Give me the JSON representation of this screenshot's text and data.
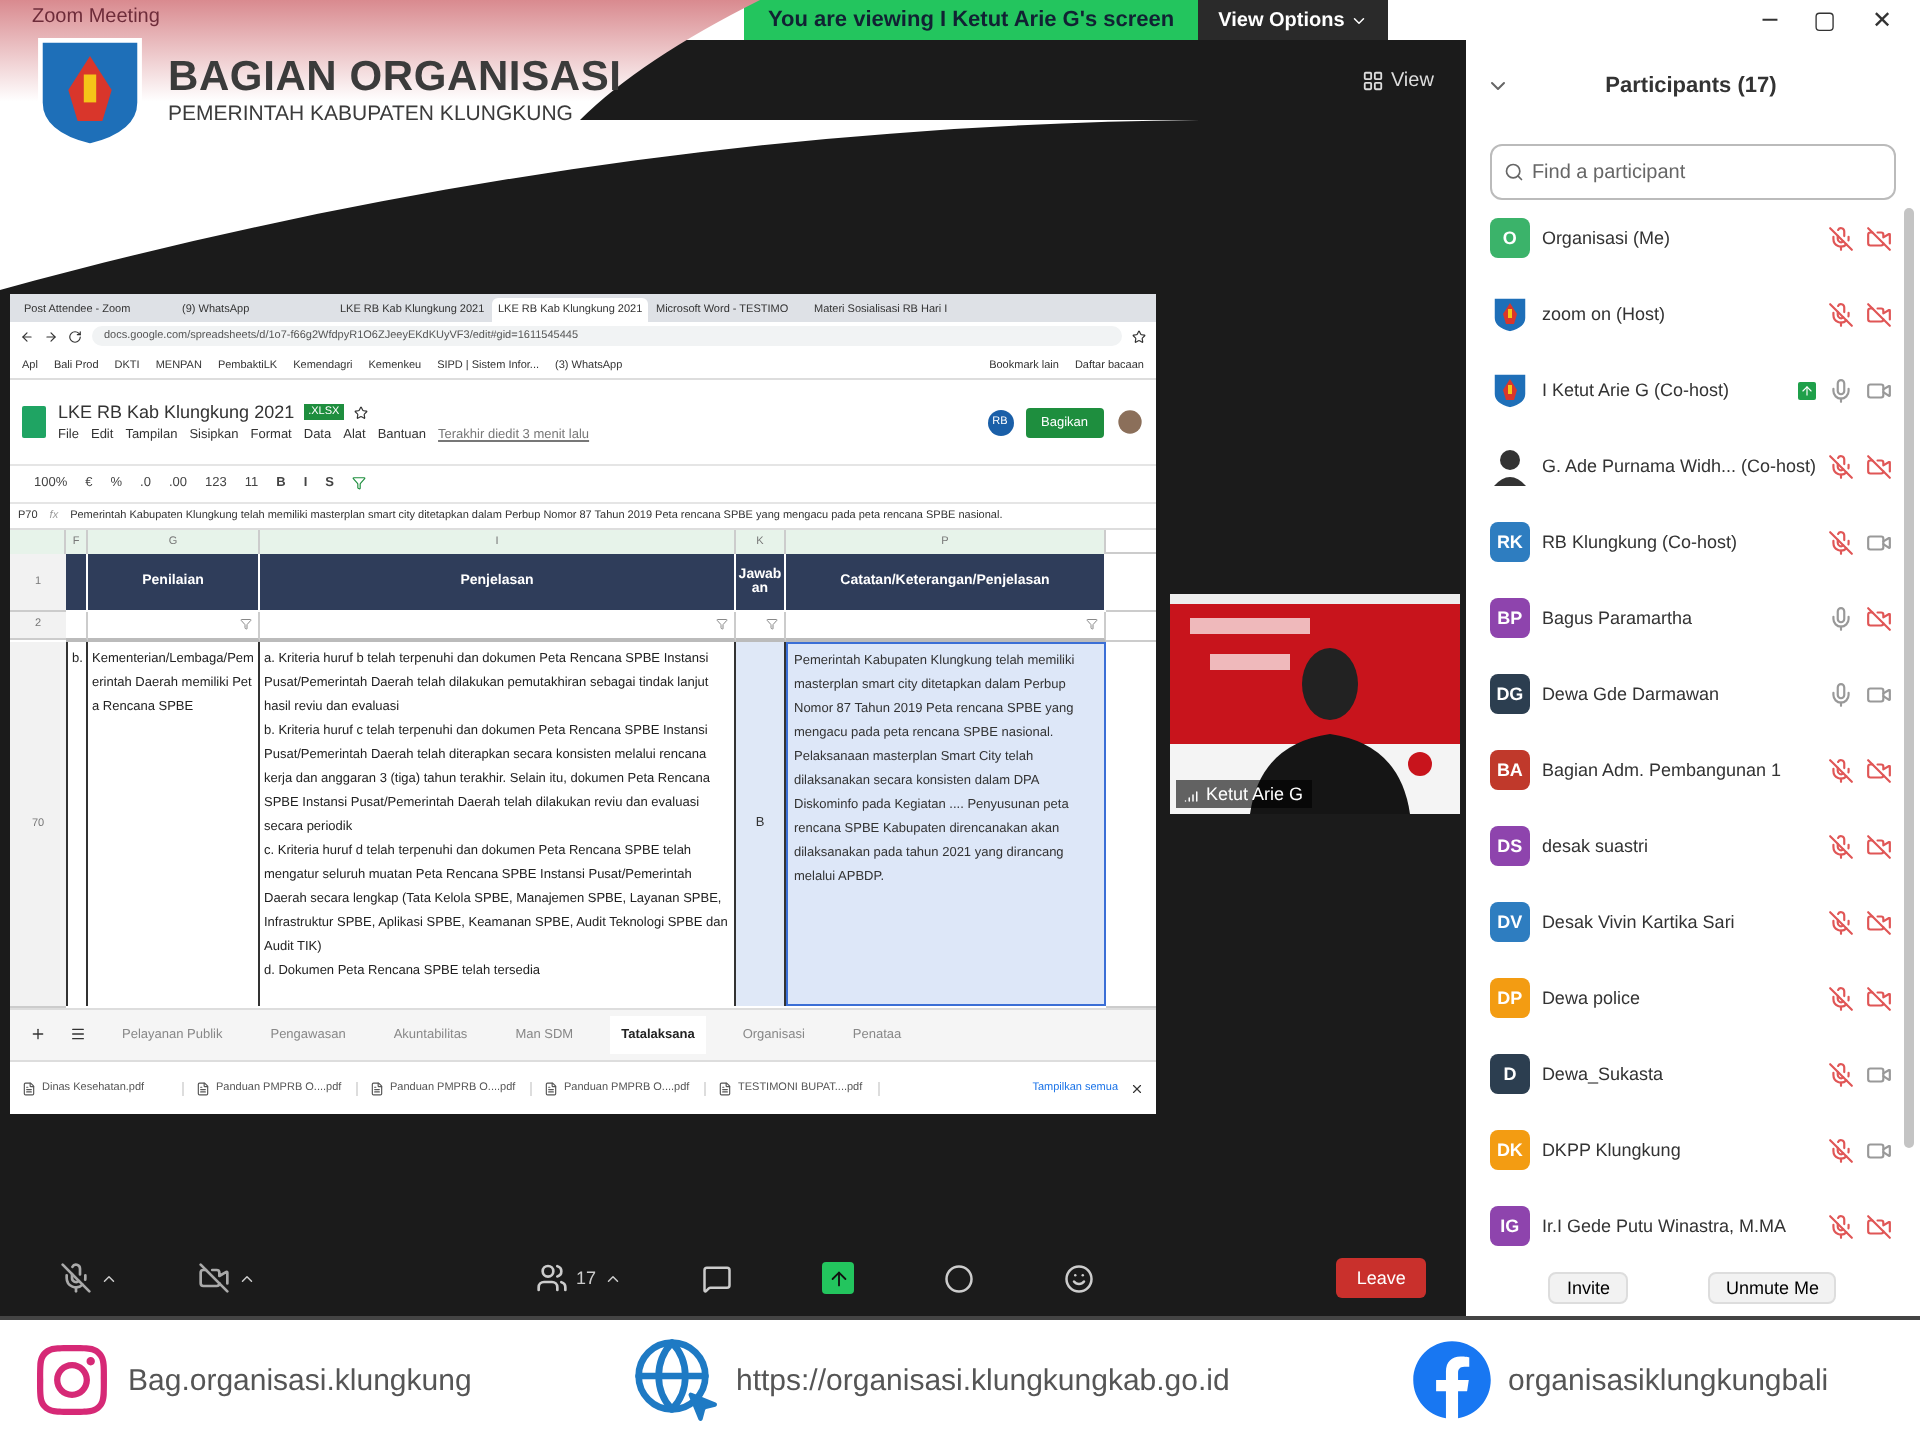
{
  "window": {
    "title": "Zoom Meeting",
    "controls": [
      "─",
      "▢",
      "✕"
    ]
  },
  "banner": {
    "title": "BAGIAN ORGANISASI",
    "subtitle": "PEMERINTAH KABUPATEN KLUNGKUNG"
  },
  "share_notice": {
    "text": "You are viewing I Ketut Arie G's screen",
    "options": "View Options"
  },
  "view_button": "View",
  "shared_screen": {
    "browser_tabs": [
      {
        "label": "Post Attendee - Zoom",
        "selected": false
      },
      {
        "label": "(9) WhatsApp",
        "selected": false
      },
      {
        "label": "LKE RB Kab Klungkung 2021",
        "selected": false
      },
      {
        "label": "LKE RB Kab Klungkung 2021",
        "selected": true
      },
      {
        "label": "Microsoft Word - TESTIMO",
        "selected": false
      },
      {
        "label": "Materi Sosialisasi RB Hari I",
        "selected": false
      }
    ],
    "url": "docs.google.com/spreadsheets/d/1o7-f66g2WfdpyR1O6ZJeeyEKdKUyVF3/edit#gid=1611545445",
    "bookmarks": [
      "Apl",
      "Bali Prod",
      "DKTI",
      "MENPAN",
      "PembaktiLK",
      "Kemendagri",
      "Kemenkeu",
      "SIPD | Sistem Infor...",
      "(3) WhatsApp"
    ],
    "bookmarks_right": [
      "Bookmark lain",
      "Daftar bacaan"
    ],
    "doc_title": "LKE RB Kab Klungkung 2021",
    "doc_badge": ".XLSX",
    "menus": [
      "File",
      "Edit",
      "Tampilan",
      "Sisipkan",
      "Format",
      "Data",
      "Alat",
      "Bantuan"
    ],
    "last_edit": "Terakhir diedit 3 menit lalu",
    "collaborator": "RB",
    "share_button": "Bagikan",
    "toolbar": [
      "100%",
      "€",
      "%",
      ".0",
      ".00",
      "123",
      "11",
      "B",
      "I",
      "S"
    ],
    "cell_ref": "P70",
    "fx": "fx",
    "formula": "Pemerintah Kabupaten Klungkung telah memiliki masterplan smart city ditetapkan dalam Perbup Nomor 87 Tahun 2019 Peta rencana SPBE yang mengacu pada peta rencana SPBE nasional.",
    "columns": [
      "F",
      "G",
      "I",
      "K",
      "P"
    ],
    "header_row": {
      "number": "1",
      "cells": [
        "Penilaian",
        "Penjelasan",
        "Jawaban",
        "Catatan/Keterangan/Penjelasan"
      ]
    },
    "filter_row": {
      "number": "2"
    },
    "row": {
      "number": "70",
      "item": "b.",
      "penilaian": "Kementerian/Lembaga/Pemerintah Daerah memiliki Peta Rencana SPBE",
      "penjelasan": [
        "a. Kriteria huruf b telah terpenuhi dan dokumen Peta Rencana SPBE Instansi Pusat/Pemerintah Daerah telah dilakukan pemutakhiran sebagai tindak lanjut hasil reviu dan evaluasi",
        "b. Kriteria huruf c telah terpenuhi dan dokumen Peta Rencana SPBE Instansi Pusat/Pemerintah Daerah telah diterapkan secara konsisten melalui rencana kerja dan anggaran 3 (tiga) tahun terakhir. Selain itu, dokumen Peta Rencana SPBE Instansi Pusat/Pemerintah Daerah telah dilakukan reviu dan evaluasi secara periodik",
        "c. Kriteria huruf d telah terpenuhi dan dokumen Peta Rencana SPBE telah mengatur seluruh muatan Peta Rencana SPBE Instansi Pusat/Pemerintah Daerah secara lengkap (Tata Kelola SPBE, Manajemen SPBE, Layanan SPBE, Infrastruktur SPBE, Aplikasi SPBE, Keamanan SPBE, Audit Teknologi SPBE dan Audit TIK)",
        "d. Dokumen Peta Rencana SPBE telah tersedia"
      ],
      "jawaban": "B",
      "catatan": "Pemerintah Kabupaten Klungkung telah memiliki masterplan smart city ditetapkan dalam Perbup Nomor 87 Tahun 2019 Peta rencana SPBE yang mengacu pada peta rencana SPBE nasional. Pelaksanaan masterplan Smart City telah dilaksanakan secara konsisten dalam DPA Diskominfo pada Kegiatan .... Penyusunan peta rencana SPBE Kabupaten direncanakan akan dilaksanakan pada tahun 2021 yang dirancang melalui APBDP."
    },
    "sheet_tabs": [
      {
        "label": "Pelayanan Publik",
        "selected": false
      },
      {
        "label": "Pengawasan",
        "selected": false
      },
      {
        "label": "Akuntabilitas",
        "selected": false
      },
      {
        "label": "Man SDM",
        "selected": false
      },
      {
        "label": "Tatalaksana",
        "selected": true
      },
      {
        "label": "Organisasi",
        "selected": false
      },
      {
        "label": "Penataa",
        "selected": false
      }
    ],
    "downloads": [
      "Dinas Kesehatan.pdf",
      "Panduan PMPRB O....pdf",
      "Panduan PMPRB O....pdf",
      "Panduan PMPRB O....pdf",
      "TESTIMONI BUPAT....pdf"
    ],
    "show_all": "Tampilkan semua"
  },
  "video_tile": {
    "name": "Ketut Arie G"
  },
  "participants": {
    "title": "Participants (17)",
    "search_placeholder": "Find a participant",
    "rows": [
      {
        "kind": "initials",
        "initials": "O",
        "color": "#3bb36a",
        "name": "Organisasi (Me)",
        "sharing": false,
        "mic_muted": true,
        "video_off": true
      },
      {
        "kind": "emblem",
        "name": "zoom on (Host)",
        "sharing": false,
        "mic_muted": true,
        "video_off": true
      },
      {
        "kind": "emblem",
        "name": "I Ketut Arie G (Co-host)",
        "sharing": true,
        "mic_muted": false,
        "video_off": false
      },
      {
        "kind": "person",
        "name": "G. Ade Purnama Widh... (Co-host)",
        "sharing": false,
        "mic_muted": true,
        "video_off": true
      },
      {
        "kind": "initials",
        "initials": "RK",
        "color": "#2e7dc0",
        "name": "RB Klungkung (Co-host)",
        "sharing": false,
        "mic_muted": true,
        "video_off": false
      },
      {
        "kind": "initials",
        "initials": "BP",
        "color": "#8e44ad",
        "name": "Bagus Paramartha",
        "sharing": false,
        "mic_muted": false,
        "video_off": true
      },
      {
        "kind": "initials",
        "initials": "DG",
        "color": "#2c3e50",
        "name": "Dewa Gde Darmawan",
        "sharing": false,
        "mic_muted": false,
        "video_off": false
      },
      {
        "kind": "initials",
        "initials": "BA",
        "color": "#c0392b",
        "name": "Bagian Adm. Pembangunan 1",
        "sharing": false,
        "mic_muted": true,
        "video_off": true
      },
      {
        "kind": "initials",
        "initials": "DS",
        "color": "#8e44ad",
        "name": "desak suastri",
        "sharing": false,
        "mic_muted": true,
        "video_off": true
      },
      {
        "kind": "initials",
        "initials": "DV",
        "color": "#2e7dc0",
        "name": "Desak Vivin Kartika Sari",
        "sharing": false,
        "mic_muted": true,
        "video_off": true
      },
      {
        "kind": "initials",
        "initials": "DP",
        "color": "#f39c12",
        "name": "Dewa police",
        "sharing": false,
        "mic_muted": true,
        "video_off": true
      },
      {
        "kind": "initials",
        "initials": "D",
        "color": "#2c3e50",
        "name": "Dewa_Sukasta",
        "sharing": false,
        "mic_muted": true,
        "video_off": false
      },
      {
        "kind": "initials",
        "initials": "DK",
        "color": "#f39c12",
        "name": "DKPP Klungkung",
        "sharing": false,
        "mic_muted": true,
        "video_off": false
      },
      {
        "kind": "initials",
        "initials": "IG",
        "color": "#8e44ad",
        "name": "Ir.I Gede Putu Winastra, M.MA",
        "sharing": false,
        "mic_muted": true,
        "video_off": true
      }
    ],
    "buttons": [
      "Invite",
      "Unmute Me"
    ]
  },
  "meeting_toolbar": {
    "mic_muted": true,
    "video_off": true,
    "participant_count": "17",
    "leave": "Leave"
  },
  "footer": [
    {
      "kind": "instagram",
      "text": "Bag.organisasi.klungkung"
    },
    {
      "kind": "web",
      "text": "https://organisasi.klungkungkab.go.id"
    },
    {
      "kind": "facebook",
      "text": "organisasiklungkungbali"
    }
  ]
}
